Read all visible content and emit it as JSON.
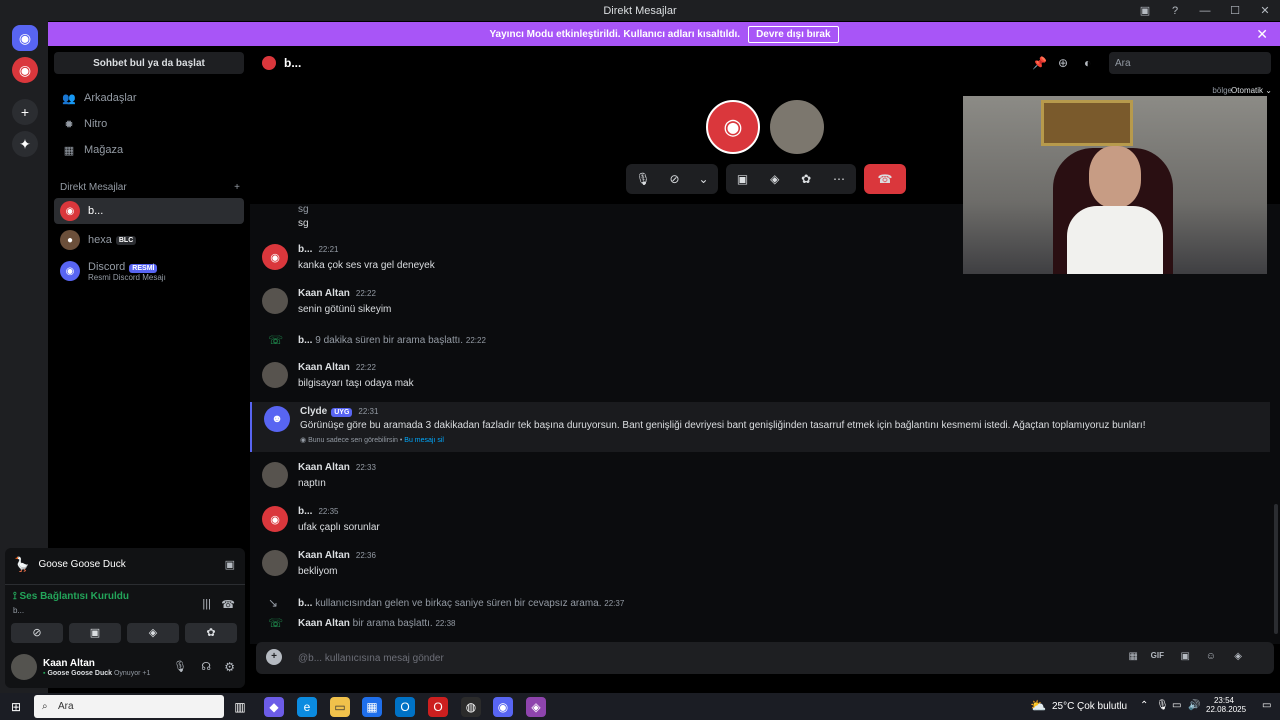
{
  "window": {
    "title": "Direkt Mesajlar"
  },
  "banner": {
    "text": "Yayıncı Modu etkinleştirildi. Kullanıcı adları kısaltıldı.",
    "button": "Devre dışı bırak"
  },
  "sidebar": {
    "search_label": "Sohbet bul ya da başlat",
    "nav": [
      {
        "label": "Arkadaşlar",
        "icon": "friends-icon"
      },
      {
        "label": "Nitro",
        "icon": "nitro-icon"
      },
      {
        "label": "Mağaza",
        "icon": "shop-icon"
      }
    ],
    "dm_header": "Direkt Mesajlar",
    "dms": [
      {
        "name": "b...",
        "sub": "",
        "badge": ""
      },
      {
        "name": "hexa",
        "sub": "",
        "badge": "BLC"
      },
      {
        "name": "Discord",
        "sub": "Resmi Discord Mesajı",
        "badge": "RESMİ"
      }
    ]
  },
  "activity": {
    "game": "Goose Goose Duck",
    "voice_status": "Ses Bağlantısı Kuruldu",
    "voice_channel": "b...",
    "user_name": "Kaan Altan",
    "user_status_game": "Goose Goose Duck",
    "user_status_suffix": "Oynuyor",
    "user_status_count": "+1"
  },
  "channel": {
    "name": "b...",
    "search_placeholder": "Ara",
    "region_label": "bölge",
    "region_value": "Otomatik"
  },
  "messages": [
    {
      "type": "text_only",
      "text": "sg"
    },
    {
      "type": "text_only",
      "text": "sg"
    },
    {
      "type": "msg",
      "author": "b...",
      "time": "22:21",
      "text": "kanka çok ses vra gel deneyek",
      "avatar": "discord"
    },
    {
      "type": "msg",
      "author": "Kaan Altan",
      "time": "22:22",
      "text": "senin götünü sikeyim",
      "avatar": "user"
    },
    {
      "type": "sys",
      "author": "b...",
      "text": "9 dakika süren bir arama başlattı.",
      "time": "22:22"
    },
    {
      "type": "msg",
      "author": "Kaan Altan",
      "time": "22:22",
      "text": "bilgisayarı taşı odaya mak",
      "avatar": "user"
    },
    {
      "type": "clyde",
      "author": "Clyde",
      "badge": "UYG",
      "time": "22:31",
      "text": "Görünüşe göre bu aramada 3 dakikadan fazladır tek başına duruyorsun. Bant genişliği devriyesi bant genişliğinden tasarruf etmek için bağlantını kesmemi istedi. Ağaçtan toplamıyoruz bunları!",
      "note": "Bunu sadece sen görebilirsin",
      "note_link": "Bu mesajı sil"
    },
    {
      "type": "msg",
      "author": "Kaan Altan",
      "time": "22:33",
      "text": "naptın",
      "avatar": "user"
    },
    {
      "type": "msg",
      "author": "b...",
      "time": "22:35",
      "text": "ufak çaplı sorunlar",
      "avatar": "discord"
    },
    {
      "type": "msg",
      "author": "Kaan Altan",
      "time": "22:36",
      "text": "bekliyom",
      "avatar": "user"
    },
    {
      "type": "sys",
      "author": "b...",
      "text": "kullanıcısından gelen ve birkaç saniye süren bir cevapsız arama.",
      "time": "22:37"
    },
    {
      "type": "sys",
      "author": "Kaan Altan",
      "text": "bir arama başlattı.",
      "time": "22:38"
    }
  ],
  "composer": {
    "placeholder": "@b... kullanıcısına mesaj gönder"
  },
  "taskbar": {
    "search": "Ara",
    "weather_temp": "25°C",
    "weather_desc": "Çok bulutlu",
    "time": "23:54",
    "date": "22.08.2025"
  },
  "colors": {
    "accent": "#5865f2",
    "banner": "#a855f7",
    "end_call": "#da373c",
    "online": "#23a55a"
  }
}
